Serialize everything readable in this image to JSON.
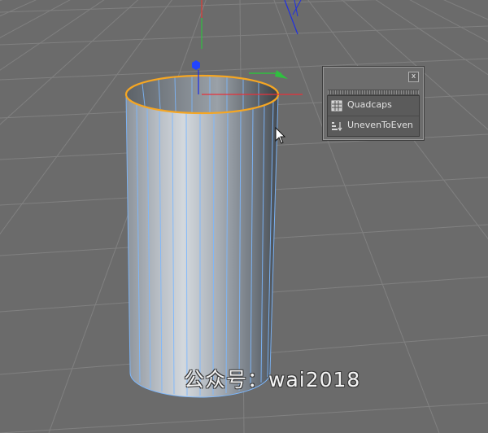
{
  "panel": {
    "close_label": "x",
    "items": [
      {
        "label": "Quadcaps",
        "icon": "grid-icon"
      },
      {
        "label": "UnevenToEven",
        "icon": "steps-icon"
      }
    ]
  },
  "watermark": "公众号：wai2018",
  "colors": {
    "viewport_background": "#6b6b6b",
    "grid_line": "#8a8a8a",
    "selection_edge": "#f5a623",
    "wireframe_edge": "#7cb8ff",
    "axis_x": "#e8303a",
    "axis_y": "#30c040",
    "axis_z": "#2030e0"
  }
}
